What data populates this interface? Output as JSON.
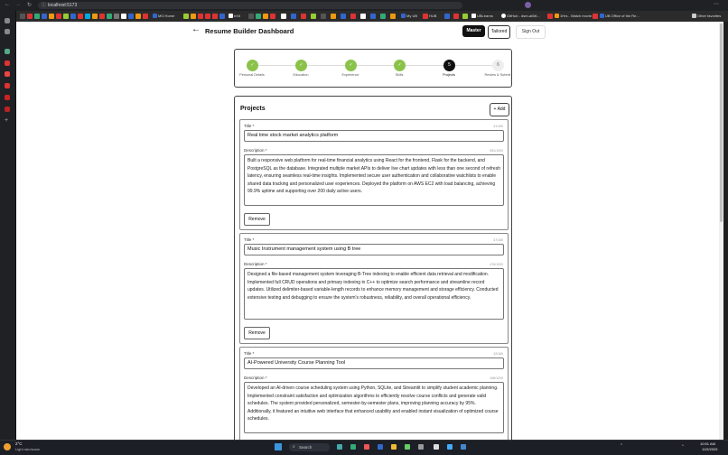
{
  "browser": {
    "url": "localhost:5173",
    "bookmarks": [
      "MG Home",
      "eXit",
      "My UB",
      "HUB",
      "UBLearns",
      "GitHub - dsm-ai/Mi...",
      "1Hrs - Watch movie...",
      "UB Office of the Re...",
      "Other favorites"
    ]
  },
  "header": {
    "title": "Resume Builder Dashboard",
    "tabs": [
      "Master",
      "Tailored"
    ],
    "signout": "Sign Out"
  },
  "stepper": {
    "steps": [
      {
        "label": "Personal Details",
        "mark": "✓"
      },
      {
        "label": "Education",
        "mark": "✓"
      },
      {
        "label": "Experience",
        "mark": "✓"
      },
      {
        "label": "Skills",
        "mark": "✓"
      },
      {
        "label": "Projects",
        "mark": "5"
      },
      {
        "label": "Review & Submit",
        "mark": "6"
      }
    ]
  },
  "section": {
    "title": "Projects",
    "add_label": "+ Add",
    "title_field_label": "Title *",
    "desc_field_label": "Description *",
    "remove_label": "Remove"
  },
  "projects": [
    {
      "title": "Real time stock market analytics platform",
      "title_count": "41/160",
      "desc_count": "551/1000",
      "description": "Built a responsive web platform for real-time financial analytics using React for the frontend, Flask for the backend, and PostgreSQL as the database. Integrated multiple market APIs to deliver live chart updates with less than one second of refresh latency, ensuring seamless real-time insights. Implemented secure user authentication and collaborative watchlists to enable shared data tracking and personalized user experiences. Deployed the platform on AWS EC2 with load balancing, achieving 99.9% uptime and supporting over 200 daily active users."
    },
    {
      "title": "Music Instrument management system using B tree",
      "title_count": "47/160",
      "desc_count": "476/1000",
      "description": "Designed a file-based management system leveraging B-Tree indexing to enable efficient data retrieval and modification. Implemented full CRUD operations and primary indexing in C++ to optimize search performance and streamline record updates. Utilized delimiter-based variable-length records to enhance memory management and storage efficiency. Conducted extensive testing and debugging to ensure the system's robustness, reliability, and overall operational efficiency."
    },
    {
      "title": "AI-Powered University Course Planning Tool",
      "title_count": "42/160",
      "desc_count": "498/1000",
      "description": "Developed an AI-driven course scheduling system using Python, SQLite, and Streamlit to simplify student academic planning. Implemented constraint satisfaction and optimization algorithms to efficiently resolve course conflicts and generate valid schedules. The system provided personalized, semester-by-semester plans, improving planning accuracy by 95%. Additionally, it featured an intuitive web interface that enhanced usability and enabled instant visualization of optimized course schedules."
    }
  ],
  "taskbar": {
    "weather_temp": "2°C",
    "weather_desc": "Light rain/snow",
    "search": "Search",
    "time": "10:51 AM",
    "date": "11/5/2025"
  },
  "colors": {
    "dark": "#111111",
    "green": "#8bc34a",
    "accent_border": "#444444"
  }
}
